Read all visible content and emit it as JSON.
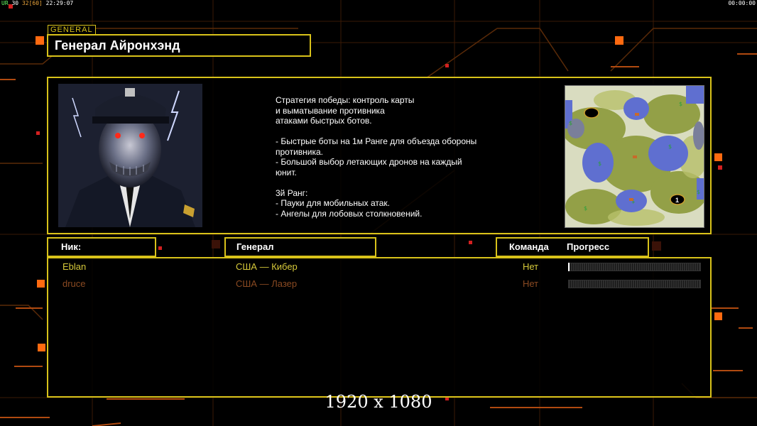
{
  "hud": {
    "fps_label": "UR",
    "fps_a": "30",
    "fps_b": "32",
    "fps_c": "[60]",
    "clock": "22:29:07",
    "timer": "00:00:00"
  },
  "general_tag": "GENERAL",
  "title": "Генерал Айронхэнд",
  "description": "Стратегия победы: контроль карты\nи выматывание противника\nатаками быстрых ботов.\n\n- Быстрые боты на 1м Ранге для объезда обороны\n противника.\n- Большой выбор летающих дронов на каждый\n юнит.\n\n3й Ранг:\n- Пауки для мобильных атак.\n- Ангелы для лобовых столкновений.",
  "headers": {
    "nick": "Ник:",
    "general": "Генерал",
    "team": "Команда",
    "progress": "Прогресс"
  },
  "players": [
    {
      "nick": "Eblan",
      "general": "США — Кибер",
      "team": "Нет",
      "color": "#d6c93a",
      "progress": 0.0
    },
    {
      "nick": "druce",
      "general": "США — Лазер",
      "team": "Нет",
      "color": "#8a4a22",
      "progress": 0.0
    }
  ],
  "minimap": {
    "start_marker": "1"
  },
  "resolution_label": "1920 x 1080",
  "colors": {
    "accent": "#d8c21a",
    "orange": "#f07a1a",
    "bg": "#000000"
  }
}
